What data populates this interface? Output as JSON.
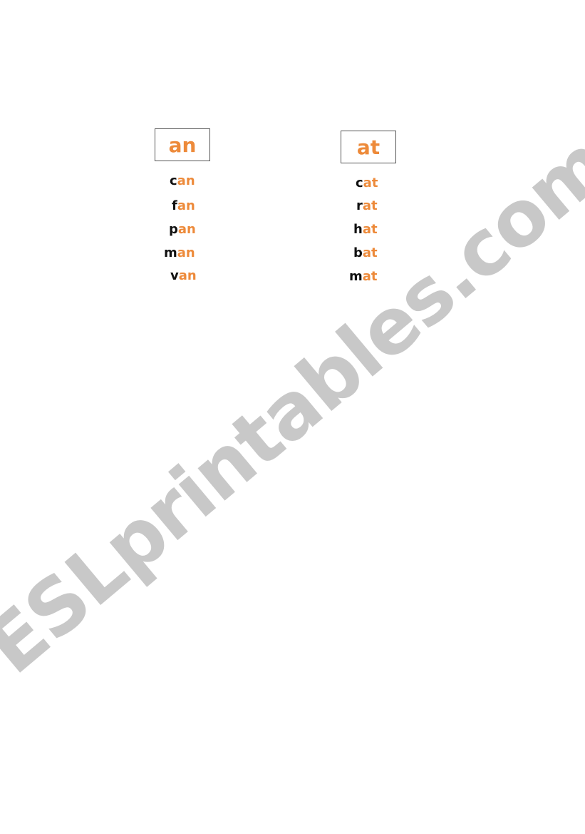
{
  "colors": {
    "rime": "#ED8A3A",
    "onset": "#111111",
    "watermark": "#C8C8C8"
  },
  "columns": [
    {
      "header": "an",
      "words": [
        {
          "onset": "c",
          "rime": "an"
        },
        {
          "onset": "f",
          "rime": "an"
        },
        {
          "onset": "p",
          "rime": "an"
        },
        {
          "onset": "m",
          "rime": "an"
        },
        {
          "onset": "v",
          "rime": "an"
        }
      ]
    },
    {
      "header": "at",
      "words": [
        {
          "onset": "c",
          "rime": "at"
        },
        {
          "onset": "r",
          "rime": "at"
        },
        {
          "onset": "h",
          "rime": "at"
        },
        {
          "onset": "b",
          "rime": "at"
        },
        {
          "onset": "m",
          "rime": "at"
        }
      ]
    }
  ],
  "watermark": "ESLprintables.com"
}
